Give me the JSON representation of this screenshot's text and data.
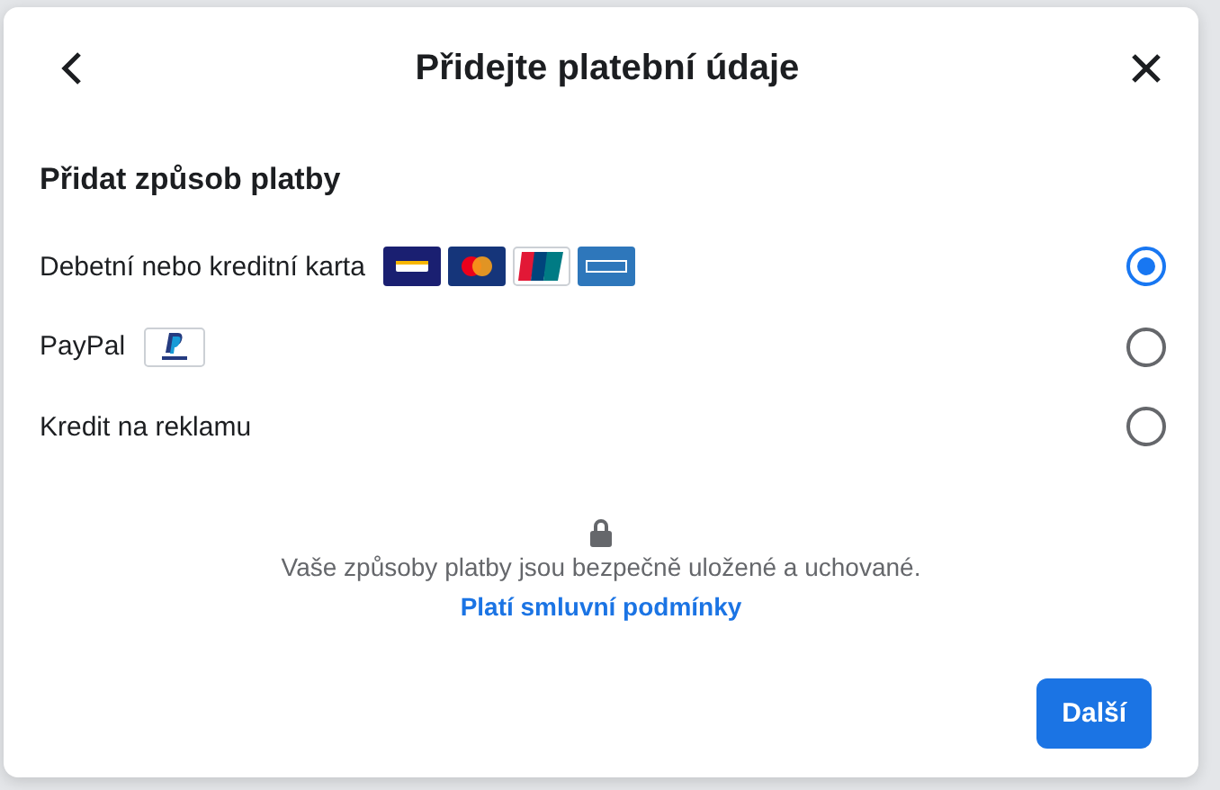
{
  "dialog": {
    "title": "Přidejte platební údaje"
  },
  "section_title": "Přidat způsob platby",
  "methods": [
    {
      "kind": "card",
      "label": "Debetní nebo kreditní karta",
      "selected": true
    },
    {
      "kind": "paypal",
      "label": "PayPal",
      "selected": false
    },
    {
      "kind": "credit",
      "label": "Kredit na reklamu",
      "selected": false
    }
  ],
  "security_note": "Vaše způsoby platby jsou bezpečně uložené a uchované.",
  "terms_link": "Platí smluvní podmínky",
  "next_button": "Další"
}
